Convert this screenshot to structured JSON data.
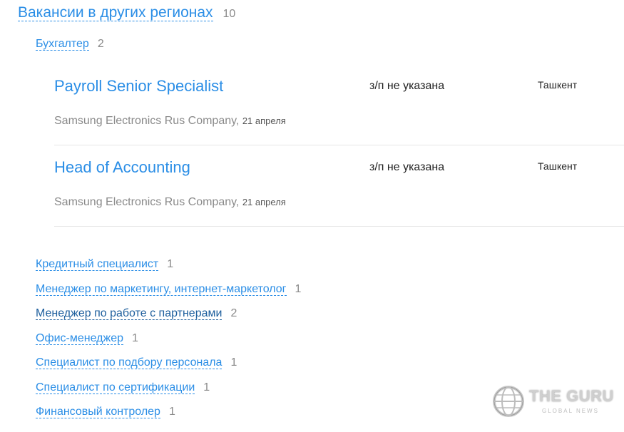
{
  "region": {
    "label": "Вакансии в других регионах",
    "count": "10"
  },
  "specialization": {
    "label": "Бухгалтер",
    "count": "2"
  },
  "vacancies": [
    {
      "title": "Payroll Senior Specialist",
      "salary": "з/п не указана",
      "city": "Ташкент",
      "company": "Samsung Electronics Rus Company",
      "separator": ",",
      "date": "21 апреля"
    },
    {
      "title": "Head of Accounting",
      "salary": "з/п не указана",
      "city": "Ташкент",
      "company": "Samsung Electronics Rus Company",
      "separator": ",",
      "date": "21 апреля"
    }
  ],
  "other_specializations": [
    {
      "label": "Кредитный специалист",
      "count": "1"
    },
    {
      "label": "Менеджер по маркетингу, интернет-маркетолог",
      "count": "1"
    },
    {
      "label": "Менеджер по работе с партнерами",
      "count": "2"
    },
    {
      "label": "Офис-менеджер",
      "count": "1"
    },
    {
      "label": "Специалист по подбору персонала",
      "count": "1"
    },
    {
      "label": "Специалист по сертификации",
      "count": "1"
    },
    {
      "label": "Финансовый контролер",
      "count": "1"
    }
  ],
  "watermark": {
    "title": "THE GURU",
    "subtitle": "GLOBAL NEWS",
    "icon": "globe-icon"
  },
  "colors": {
    "link": "#2b8ee6",
    "visited_link": "#1e5f9d",
    "muted": "#8a8a8a",
    "divider": "#e6e6e6"
  }
}
